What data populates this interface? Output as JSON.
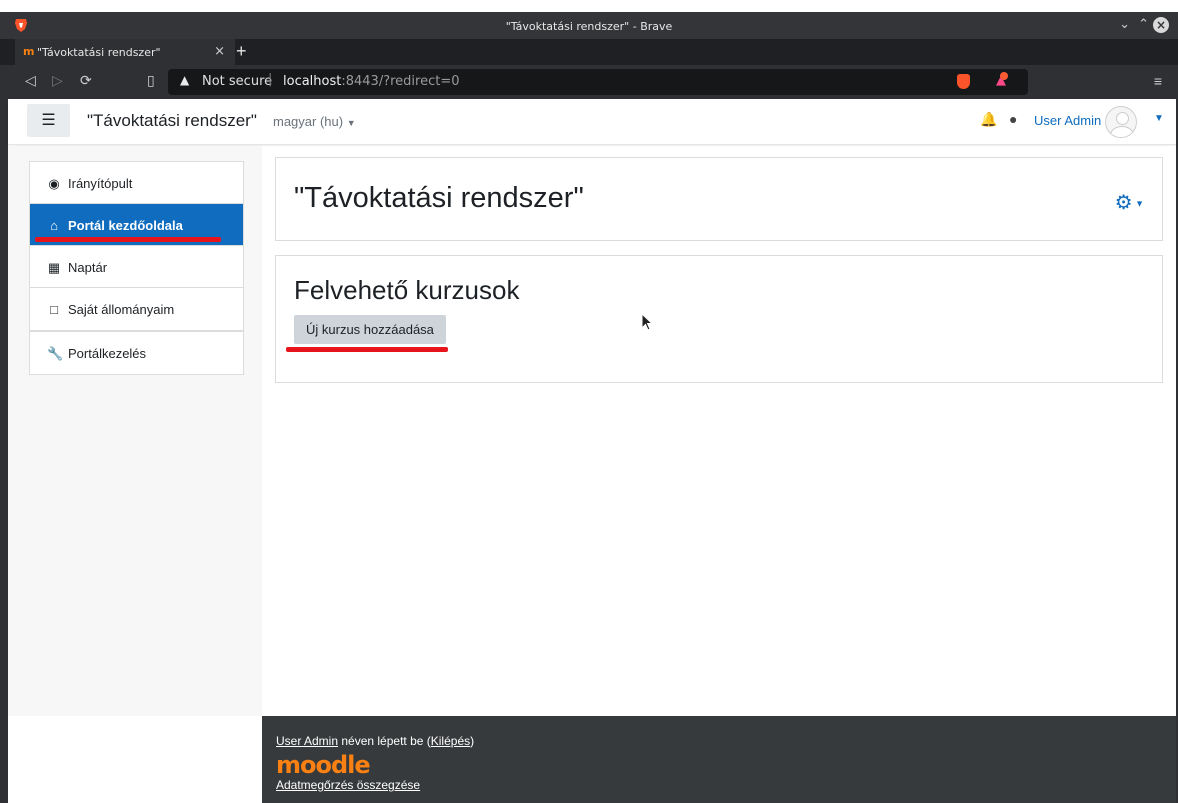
{
  "browser": {
    "window_title": "\"Távoktatási rendszer\" - Brave",
    "tab_title": "\"Távoktatási rendszer\"",
    "security_label": "Not secure",
    "url_host": "localhost",
    "url_path": ":8443/?redirect=0"
  },
  "navbar": {
    "site_name": "\"Távoktatási rendszer\"",
    "language": "magyar (hu)",
    "user_name": "User Admin"
  },
  "drawer": {
    "items": [
      {
        "label": "Irányítópult",
        "icon": "dashboard-icon"
      },
      {
        "label": "Portál kezdőoldala",
        "icon": "home-icon",
        "active": true
      },
      {
        "label": "Naptár",
        "icon": "calendar-icon"
      },
      {
        "label": "Saját állományaim",
        "icon": "file-icon"
      }
    ],
    "admin": {
      "label": "Portálkezelés",
      "icon": "wrench-icon"
    }
  },
  "main": {
    "page_title": "\"Távoktatási rendszer\"",
    "section_title": "Felvehető kurzusok",
    "add_course_button": "Új kurzus hozzáadása"
  },
  "footer": {
    "user_link": "User Admin",
    "logged_in_text": " néven lépett be (",
    "logout_link": "Kilépés",
    "logged_in_close": ")",
    "logo_text": "moodle",
    "privacy_link": "Adatmegőrzés összegzése"
  },
  "colors": {
    "primary": "#0f6cbf",
    "annotation_red": "#e8141b",
    "footer_bg": "#373a3c",
    "moodle_orange": "#f98012"
  }
}
